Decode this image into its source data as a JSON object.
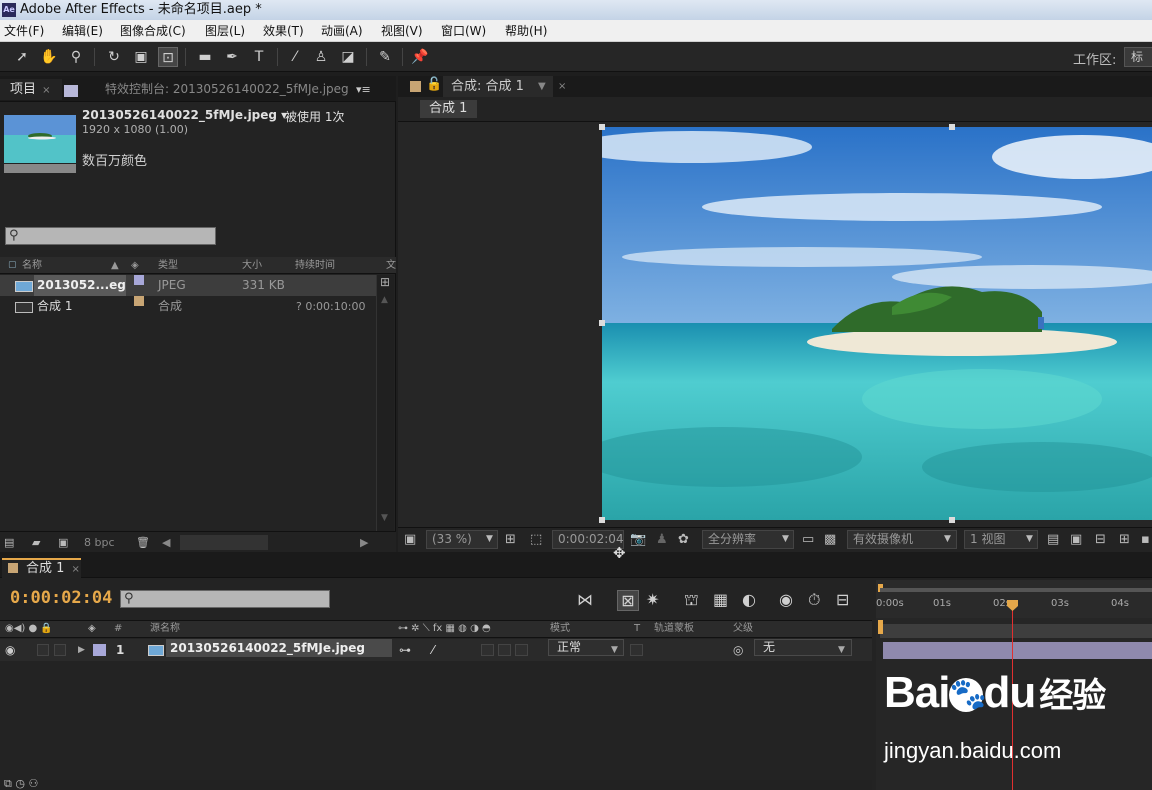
{
  "window": {
    "title": "Adobe After Effects - 未命名项目.aep *",
    "logo_text": "Ae"
  },
  "menu": [
    "文件(F)",
    "编辑(E)",
    "图像合成(C)",
    "图层(L)",
    "效果(T)",
    "动画(A)",
    "视图(V)",
    "窗口(W)",
    "帮助(H)"
  ],
  "toolbar": {
    "tools": [
      "selection-tool",
      "hand-tool",
      "zoom-tool",
      "rotate-tool",
      "camera-tool",
      "pan-behind-tool",
      "rectangle-tool",
      "pen-tool",
      "type-tool",
      "brush-tool",
      "clone-stamp-tool",
      "eraser-tool",
      "roto-brush-tool",
      "puppet-pin-tool"
    ],
    "workspace_label": "工作区:",
    "workspace_value": "标"
  },
  "project_panel": {
    "tab_project": "项目",
    "tab_effects": "特效控制台: 20130526140022_5fMJe.jpeg",
    "selected_item": {
      "name": "20130526140022_5fMJe.jpeg ▾",
      "usage": "被使用 1次",
      "dimensions": "1920 x 1080 (1.00)",
      "colors": "数百万颜色"
    },
    "columns": {
      "name": "名称",
      "type": "类型",
      "size": "大小",
      "duration": "持续时间",
      "extra": "文"
    },
    "items": [
      {
        "name": "2013052...eg",
        "type": "JPEG",
        "size": "331 KB",
        "duration": "",
        "label_color": "#a7a7d8"
      },
      {
        "name": "合成 1",
        "type": "合成",
        "size": "",
        "duration": "? 0:00:10:00",
        "label_color": "#c8a574"
      }
    ],
    "footer_bpc": "8 bpc"
  },
  "viewer": {
    "tab_title": "合成: 合成 1",
    "comp_name": "合成 1",
    "zoom": "(33 %)",
    "timecode": "0:00:02:04",
    "resolution": "全分辨率",
    "camera": "有效摄像机",
    "views": "1 视图"
  },
  "timeline": {
    "tab": "合成 1",
    "timecode": "0:00:02:04",
    "columns": {
      "num": "#",
      "source": "源名称",
      "mode": "模式",
      "t": "T",
      "trkmat": "轨道蒙板",
      "parent": "父级"
    },
    "layer": {
      "index": "1",
      "name": "20130526140022_5fMJe.jpeg",
      "mode": "正常",
      "parent": "无"
    },
    "ruler": [
      "0:00s",
      "01s",
      "02s",
      "03s",
      "04s"
    ],
    "playhead_fraction": 0.52
  },
  "watermark": {
    "brand": "Bai",
    "brand2": "du",
    "cn": "经验",
    "url": "jingyan.baidu.com"
  },
  "colors": {
    "accent": "#e6a84a",
    "layer_bar": "#8f89ad",
    "playhead": "#e03030"
  }
}
